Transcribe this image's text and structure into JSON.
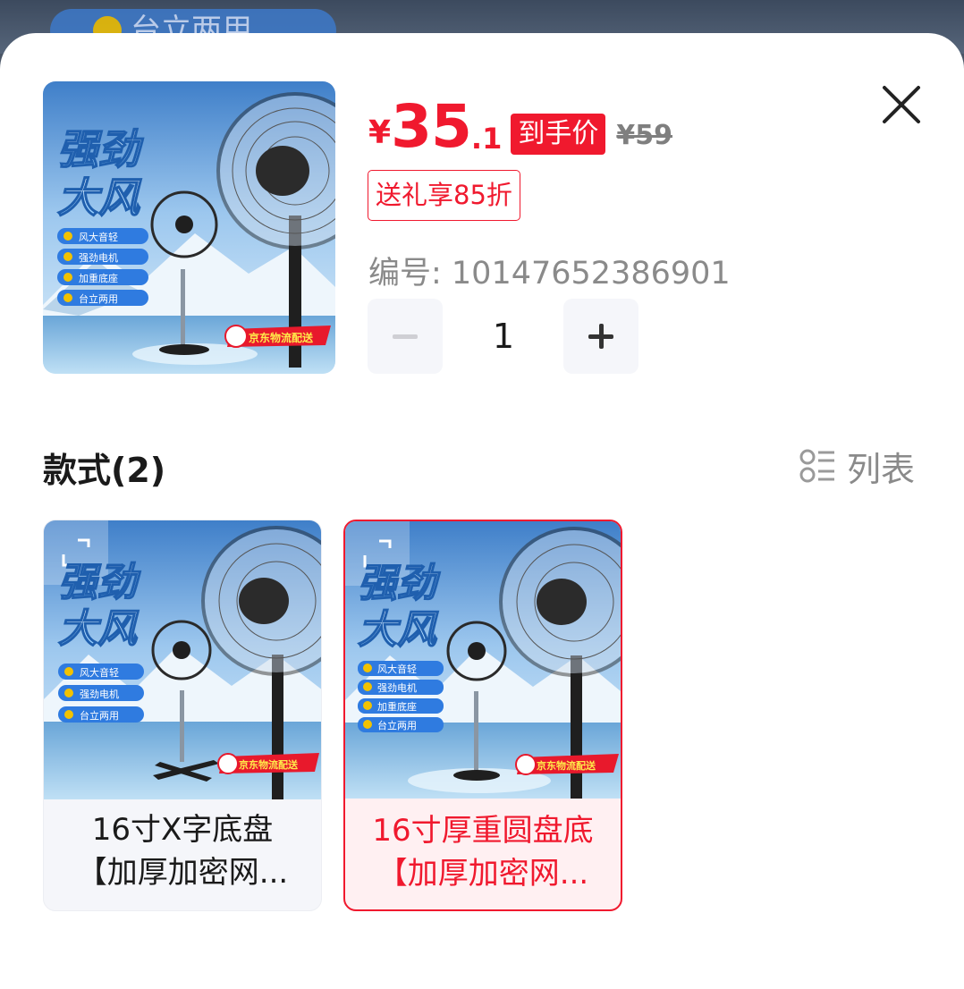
{
  "background": {
    "chip_text": "台立两用"
  },
  "product": {
    "currency": "¥",
    "price_int": "35",
    "price_dec": ".1",
    "price_tag": "到手价",
    "original_price": "¥59",
    "promo_tag": "送礼享85折",
    "sku_label": "编号: 10147652386901",
    "quantity": "1",
    "image": {
      "headline_1": "强劲",
      "headline_2": "大风",
      "features": [
        "风大音轻",
        "强劲电机",
        "加重底座",
        "台立两用"
      ],
      "badge": "京东物流配送"
    }
  },
  "styles_section": {
    "title": "款式(2)",
    "list_toggle_label": "列表",
    "options": [
      {
        "line1": "16寸X字底盘",
        "line2": "【加厚加密网...",
        "selected": false,
        "features": [
          "风大音轻",
          "强劲电机",
          "台立两用"
        ],
        "badge": "京东物流配送"
      },
      {
        "line1": "16寸厚重圆盘底",
        "line2": "【加厚加密网...",
        "selected": true,
        "features": [
          "风大音轻",
          "强劲电机",
          "加重底座",
          "台立两用"
        ],
        "badge": "京东物流配送"
      }
    ]
  },
  "colors": {
    "accent_red": "#f0192e",
    "muted_gray": "#8a8a8a",
    "selected_bg": "#fff0f2",
    "card_bg": "#f5f6fa"
  },
  "icons": [
    "close-icon",
    "minus-icon",
    "plus-icon",
    "list-view-icon",
    "expand-corner-icon",
    "check-icon"
  ]
}
